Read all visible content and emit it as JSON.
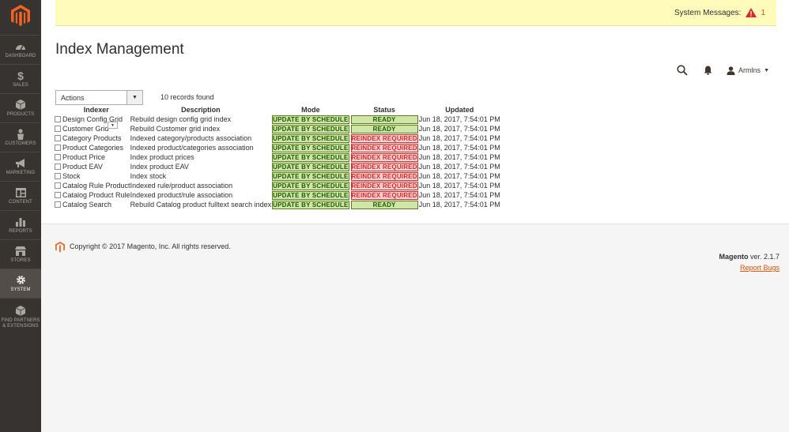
{
  "sidebar": {
    "items": [
      {
        "label": "DASHBOARD",
        "icon": "dashboard-icon"
      },
      {
        "label": "SALES",
        "icon": "dollar-icon"
      },
      {
        "label": "PRODUCTS",
        "icon": "cube-icon"
      },
      {
        "label": "CUSTOMERS",
        "icon": "person-icon"
      },
      {
        "label": "MARKETING",
        "icon": "megaphone-icon"
      },
      {
        "label": "CONTENT",
        "icon": "layout-icon"
      },
      {
        "label": "REPORTS",
        "icon": "bar-chart-icon"
      },
      {
        "label": "STORES",
        "icon": "store-icon"
      },
      {
        "label": "SYSTEM",
        "icon": "gear-icon",
        "active": true
      },
      {
        "label_line1": "FIND PARTNERS",
        "label_line2": "& EXTENSIONS",
        "icon": "partners-icon"
      }
    ]
  },
  "system_messages": {
    "label": "System Messages:",
    "count": "1"
  },
  "page_title": "Index Management",
  "header": {
    "user_name": "Armlns"
  },
  "actions": {
    "label": "Actions"
  },
  "records_found": "10 records found",
  "grid": {
    "columns": [
      "Indexer",
      "Description",
      "Mode",
      "Status",
      "Updated"
    ],
    "rows": [
      {
        "indexer": "Design Config Grid",
        "description": "Rebuild design config grid index",
        "mode": "UPDATE BY SCHEDULE",
        "status": "READY",
        "status_type": "green",
        "updated": "Jun 18, 2017, 7:54:01 PM"
      },
      {
        "indexer": "Customer Grid",
        "description": "Rebuild Customer grid index",
        "mode": "UPDATE BY SCHEDULE",
        "status": "READY",
        "status_type": "green",
        "updated": "Jun 18, 2017, 7:54:01 PM"
      },
      {
        "indexer": "Category Products",
        "description": "Indexed category/products association",
        "mode": "UPDATE BY SCHEDULE",
        "status": "REINDEX REQUIRED",
        "status_type": "red",
        "updated": "Jun 18, 2017, 7:54:01 PM"
      },
      {
        "indexer": "Product Categories",
        "description": "Indexed product/categories association",
        "mode": "UPDATE BY SCHEDULE",
        "status": "REINDEX REQUIRED",
        "status_type": "red",
        "updated": "Jun 18, 2017, 7:54:01 PM"
      },
      {
        "indexer": "Product Price",
        "description": "Index product prices",
        "mode": "UPDATE BY SCHEDULE",
        "status": "REINDEX REQUIRED",
        "status_type": "red",
        "updated": "Jun 18, 2017, 7:54:01 PM"
      },
      {
        "indexer": "Product EAV",
        "description": "Index product EAV",
        "mode": "UPDATE BY SCHEDULE",
        "status": "REINDEX REQUIRED",
        "status_type": "red",
        "updated": "Jun 18, 2017, 7:54:01 PM"
      },
      {
        "indexer": "Stock",
        "description": "Index stock",
        "mode": "UPDATE BY SCHEDULE",
        "status": "REINDEX REQUIRED",
        "status_type": "red",
        "updated": "Jun 18, 2017, 7:54:01 PM"
      },
      {
        "indexer": "Catalog Rule Product",
        "description": "Indexed rule/product association",
        "mode": "UPDATE BY SCHEDULE",
        "status": "REINDEX REQUIRED",
        "status_type": "red",
        "updated": "Jun 18, 2017, 7:54:01 PM"
      },
      {
        "indexer": "Catalog Product Rule",
        "description": "Indexed product/rule association",
        "mode": "UPDATE BY SCHEDULE",
        "status": "REINDEX REQUIRED",
        "status_type": "red",
        "updated": "Jun 18, 2017, 7:54:01 PM"
      },
      {
        "indexer": "Catalog Search",
        "description": "Rebuild Catalog product fulltext search index",
        "mode": "UPDATE BY SCHEDULE",
        "status": "READY",
        "status_type": "green",
        "updated": "Jun 18, 2017, 7:54:01 PM"
      }
    ]
  },
  "footer": {
    "copyright": "Copyright © 2017 Magento, Inc. All rights reserved.",
    "brand": "Magento",
    "version": "ver. 2.1.7",
    "report_bugs": "Report Bugs"
  },
  "colors": {
    "sidebar_bg": "#373330",
    "accent": "#eb5202",
    "message_bg": "#fffbbb",
    "ready_bg": "#d0e5a9",
    "reindex_bg": "#f9d4d4"
  }
}
